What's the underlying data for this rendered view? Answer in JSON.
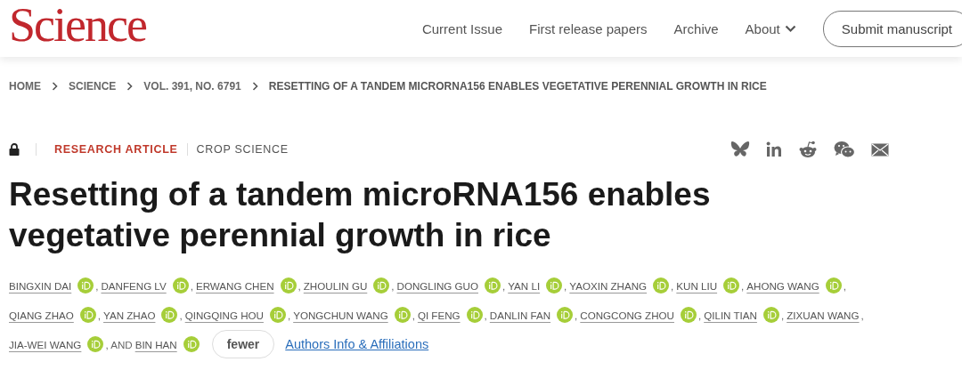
{
  "header": {
    "logo": "Science",
    "nav": [
      {
        "label": "Current Issue",
        "kind": "link"
      },
      {
        "label": "First release papers",
        "kind": "link"
      },
      {
        "label": "Archive",
        "kind": "link"
      },
      {
        "label": "About",
        "kind": "menu"
      }
    ],
    "submit_button": "Submit manuscript"
  },
  "breadcrumb": [
    "HOME",
    "SCIENCE",
    "VOL. 391, NO. 6791",
    "RESETTING OF A TANDEM MICRORNA156 ENABLES VEGETATIVE PERENNIAL GROWTH IN RICE"
  ],
  "article": {
    "locked": true,
    "type": "RESEARCH ARTICLE",
    "section": "CROP SCIENCE",
    "title": "Resetting of a tandem microRNA156 enables vegetative perennial growth in rice",
    "author_lines": [
      [
        {
          "name": "BINGXIN DAI",
          "orcid": true,
          "after": ","
        },
        {
          "name": "DANFENG LV",
          "orcid": true,
          "after": ","
        },
        {
          "name": "ERWANG CHEN",
          "orcid": true,
          "after": ","
        },
        {
          "name": "ZHOULIN GU",
          "orcid": true,
          "after": ","
        },
        {
          "name": "DONGLING GUO",
          "orcid": true,
          "after": ","
        },
        {
          "name": "YAN LI",
          "orcid": true,
          "after": ","
        },
        {
          "name": "YAOXIN ZHANG",
          "orcid": true,
          "after": ","
        },
        {
          "name": "KUN LIU",
          "orcid": true,
          "after": ","
        },
        {
          "name": "AHONG WANG",
          "orcid": true,
          "after": ","
        }
      ],
      [
        {
          "name": "QIANG ZHAO",
          "orcid": true,
          "after": ","
        },
        {
          "name": "YAN ZHAO",
          "orcid": true,
          "after": ","
        },
        {
          "name": "QINGQING HOU",
          "orcid": true,
          "after": ","
        },
        {
          "name": "YONGCHUN WANG",
          "orcid": true,
          "after": ","
        },
        {
          "name": "QI FENG",
          "orcid": true,
          "after": ","
        },
        {
          "name": "DANLIN FAN",
          "orcid": true,
          "after": ","
        },
        {
          "name": "CONGCONG ZHOU",
          "orcid": true,
          "after": ","
        },
        {
          "name": "QILIN TIAN",
          "orcid": true,
          "after": ","
        },
        {
          "name": "ZIXUAN WANG",
          "orcid": false,
          "after": ","
        }
      ],
      [
        {
          "name": "JIA-WEI WANG",
          "orcid": true,
          "after": ", AND"
        },
        {
          "name": "BIN HAN",
          "orcid": true
        }
      ]
    ],
    "fewer_button": "fewer",
    "affiliations_link": "Authors Info & Affiliations"
  }
}
